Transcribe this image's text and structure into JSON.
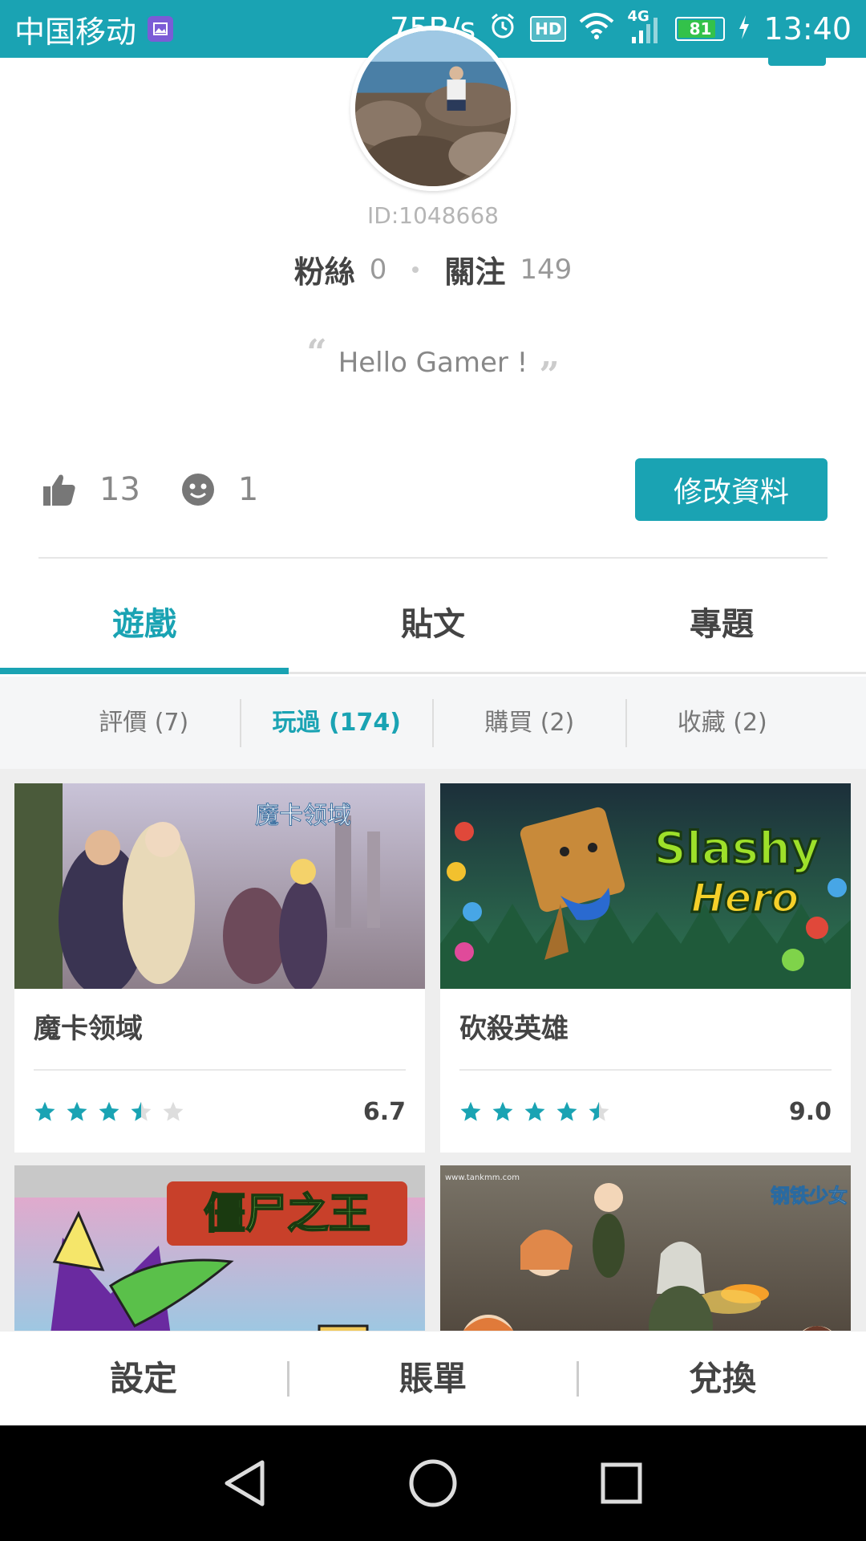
{
  "status_bar": {
    "carrier": "中国移动",
    "speed": "75B/s",
    "hd": "HD",
    "network": "4G",
    "battery": "81",
    "time": "13:40"
  },
  "profile": {
    "id": "ID:1048668",
    "fans_label": "粉絲",
    "fans_count": "0",
    "follow_label": "關注",
    "follow_count": "149",
    "motto": "Hello Gamer !",
    "likes": "13",
    "emoji_count": "1",
    "edit_label": "修改資料"
  },
  "tabs": [
    {
      "label": "遊戲",
      "active": true
    },
    {
      "label": "貼文",
      "active": false
    },
    {
      "label": "專題",
      "active": false
    }
  ],
  "subtabs": [
    {
      "label": "評價 (7)",
      "active": false
    },
    {
      "label": "玩過 (174)",
      "active": true
    },
    {
      "label": "購買 (2)",
      "active": false
    },
    {
      "label": "收藏 (2)",
      "active": false
    }
  ],
  "games": [
    {
      "name": "魔卡领域",
      "score": "6.7",
      "stars": 3.5
    },
    {
      "name": "砍殺英雄",
      "score": "9.0",
      "stars": 4.5
    },
    {
      "name": "",
      "score": "",
      "stars": 0
    },
    {
      "name": "",
      "score": "",
      "stars": 0
    }
  ],
  "thumb_text": {
    "game1": "魔卡领域",
    "game2_line1": "Slashy",
    "game2_line2": "Hero",
    "game3": "僵尸之王",
    "game4_site": "www.tankmm.com",
    "game4_title": "钢铁少女"
  },
  "bottom_menu": {
    "settings": "設定",
    "bill": "賬單",
    "redeem": "兌換"
  },
  "colors": {
    "accent": "#1aa3b3",
    "star_filled": "#1aa3b3",
    "star_empty": "#dddddd"
  }
}
